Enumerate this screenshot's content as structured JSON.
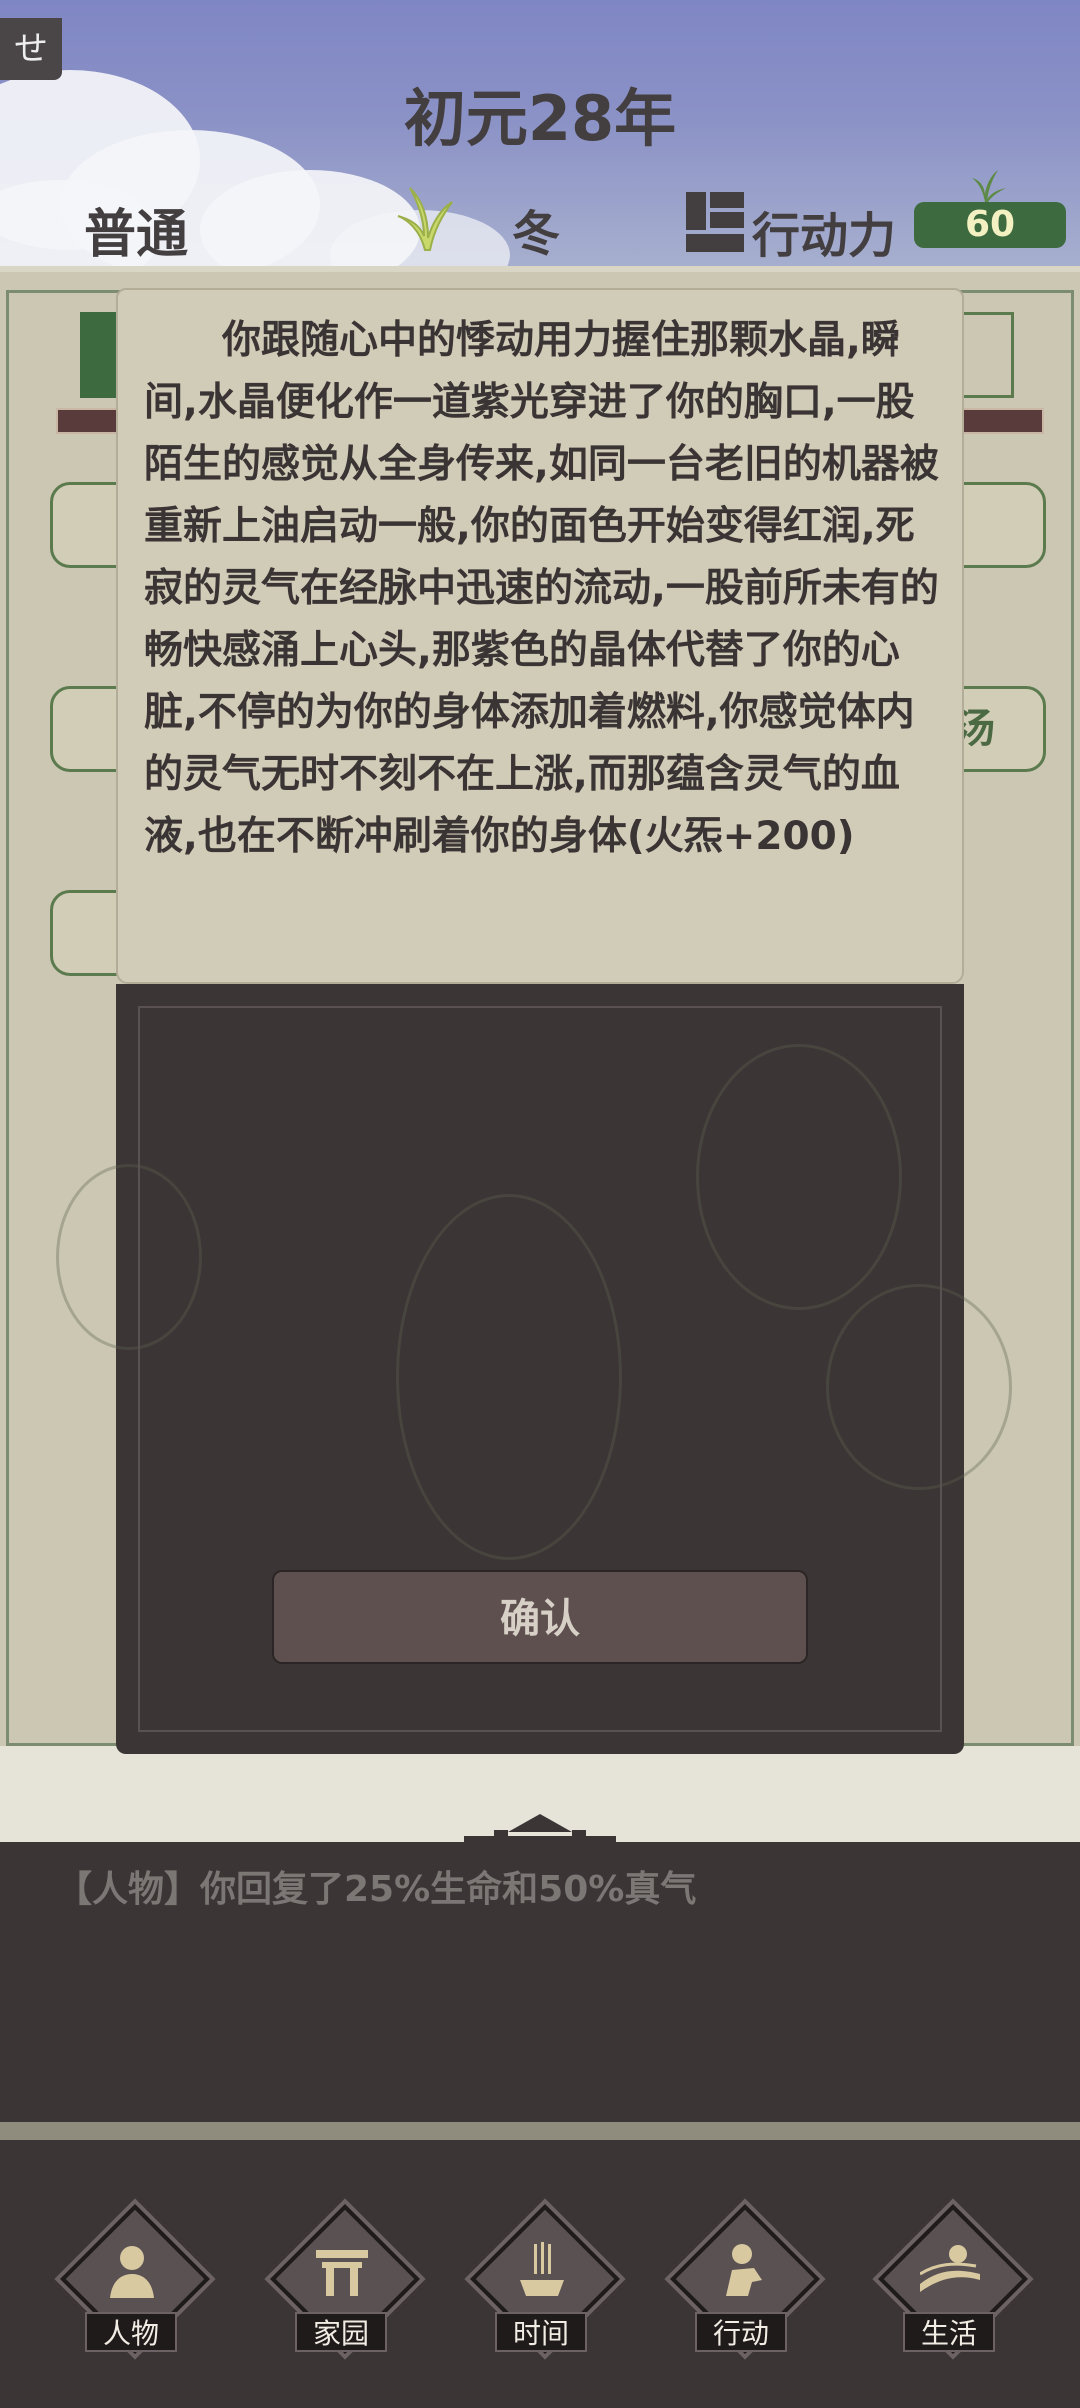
{
  "header": {
    "corner_tag": "せ",
    "year_title": "初元28年",
    "mode": "普通",
    "season": "冬",
    "action_label": "行动力",
    "action_value": "60"
  },
  "background": {
    "left_buttons_hint": [
      "",
      "",
      ""
    ],
    "right_button_hint": "汤"
  },
  "modal": {
    "text": "　　你跟随心中的悸动用力握住那颗水晶,瞬间,水晶便化作一道紫光穿进了你的胸口,一股陌生的感觉从全身传来,如同一台老旧的机器被重新上油启动一般,你的面色开始变得红润,死寂的灵气在经脉中迅速的流动,一股前所未有的畅快感涌上心头,那紫色的晶体代替了你的心脏,不停的为你的身体添加着燃料,你感觉体内的灵气无时不刻不在上涨,而那蕴含灵气的血液,也在不断冲刷着你的身体(火炁+200)",
    "confirm_label": "确认"
  },
  "log": {
    "message": "【人物】你回复了25%生命和50%真气"
  },
  "nav": {
    "items": [
      {
        "label": "人物",
        "icon": "person-icon"
      },
      {
        "label": "家园",
        "icon": "gate-icon"
      },
      {
        "label": "时间",
        "icon": "incense-icon"
      },
      {
        "label": "行动",
        "icon": "action-icon"
      },
      {
        "label": "生活",
        "icon": "life-icon"
      }
    ]
  },
  "colors": {
    "sky": "#8b92c6",
    "panel": "#cbc7b3",
    "dark": "#3b3535",
    "accent_green": "#3e6a40",
    "button": "#5f5050"
  }
}
